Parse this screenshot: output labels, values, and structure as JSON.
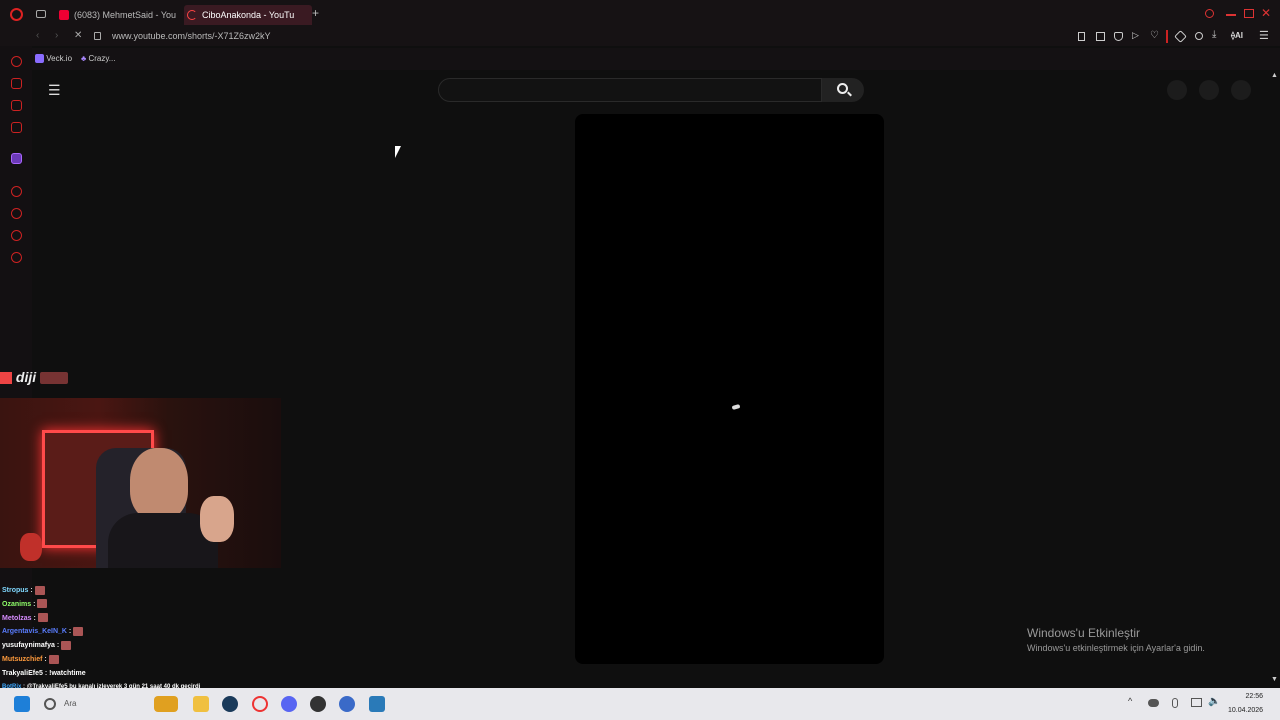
{
  "browser": {
    "tabs": [
      {
        "label": "(6083) MehmetSaid - You"
      },
      {
        "label": "CiboAnakonda - YouTu"
      }
    ],
    "new_tab": "+",
    "url": "www.youtube.com/shorts/-X71Z6zw2kY",
    "bookmarks": [
      {
        "label": "Veck.io"
      },
      {
        "label": "Crazy..."
      }
    ],
    "toolbar_ai": "AI"
  },
  "youtube": {
    "search_placeholder": ""
  },
  "stream_overlay": {
    "logo_text": "diji",
    "chat": [
      {
        "user": "Stropus",
        "color": "#7fd8ff",
        "message": ""
      },
      {
        "user": "Ozanims",
        "color": "#8fff6a",
        "message": ""
      },
      {
        "user": "Metolzas",
        "color": "#d78cff",
        "message": ""
      },
      {
        "user": "Argentavis_KeIN_K",
        "color": "#5a7dff",
        "message": ""
      },
      {
        "user": "yusufaynimafya",
        "color": "#ffffff",
        "message": ""
      },
      {
        "user": "Mutsuzchief",
        "color": "#ff9a3c",
        "message": ""
      },
      {
        "user": "TrakyaliEfe5",
        "color": "#ffffff",
        "message": "!watchtime"
      },
      {
        "user": "BotRix",
        "color": "#3ca8ff",
        "message": "@TrakyaliEfe5 bu kanalı izleyerek 3 gün 21 saat 40 dk geçirdi"
      }
    ]
  },
  "activation": {
    "title": "Windows'u Etkinleştir",
    "subtitle": "Windows'u etkinleştirmek için Ayarlar'a gidin."
  },
  "taskbar": {
    "search_label": "Ara",
    "time": "22:56",
    "date": "10.04.2026"
  },
  "colors": {
    "accent": "#e0223c",
    "youtube_bg": "#0f0f0f"
  }
}
